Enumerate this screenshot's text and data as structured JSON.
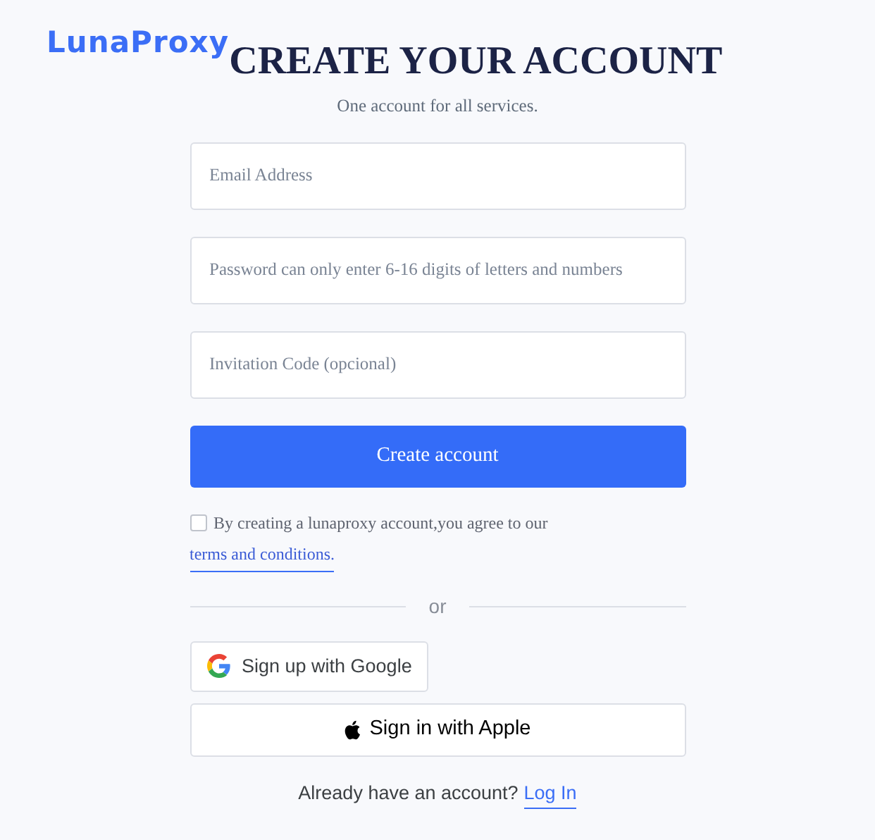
{
  "logo": "LunaProxy",
  "title": "CREATE YOUR ACCOUNT",
  "subtitle": "One account for all services.",
  "fields": [
    {
      "placeholder": "Email Address"
    },
    {
      "placeholder": "Password can only enter 6-16 digits of letters and numbers"
    },
    {
      "placeholder": "Invitation Code (opcional)"
    }
  ],
  "submit": "Create account",
  "agreement": {
    "checked": false,
    "text": "By creating a lunaproxy account,you agree to our",
    "link": "terms and conditions."
  },
  "divider": "or",
  "social": [
    {
      "kind": "google",
      "label": "Sign up with Google"
    },
    {
      "kind": "apple",
      "label": "Sign in with Apple"
    }
  ],
  "footer": {
    "text": "Already have an account?",
    "link": "Log In"
  }
}
